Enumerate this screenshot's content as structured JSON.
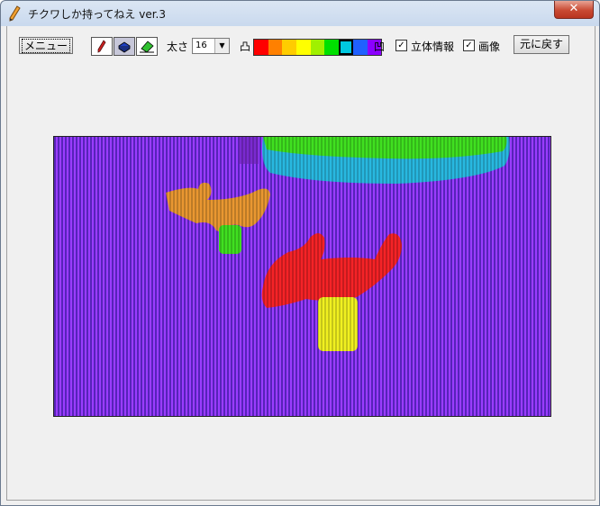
{
  "window": {
    "title": "チクワしか持ってねえ ver.3",
    "close_label": "✕"
  },
  "toolbar": {
    "menu_label": "メニュー",
    "tools": [
      {
        "name": "pen-icon",
        "selected": false
      },
      {
        "name": "bucket-icon",
        "selected": true
      },
      {
        "name": "eraser-icon",
        "selected": false
      }
    ],
    "thickness_label": "太さ",
    "thickness_value": "16",
    "convex_label": "凸",
    "concave_label": "凹",
    "palette": [
      "#ff0000",
      "#ff8000",
      "#ffcc00",
      "#ffff00",
      "#a0f000",
      "#00e000",
      "#00c8e0",
      "#2060ff",
      "#8a00ff"
    ],
    "selected_color_index": 6,
    "stereo_label": "立体情報",
    "stereo_checked": true,
    "image_label": "画像",
    "image_checked": true,
    "reset_label": "元に戻す"
  }
}
